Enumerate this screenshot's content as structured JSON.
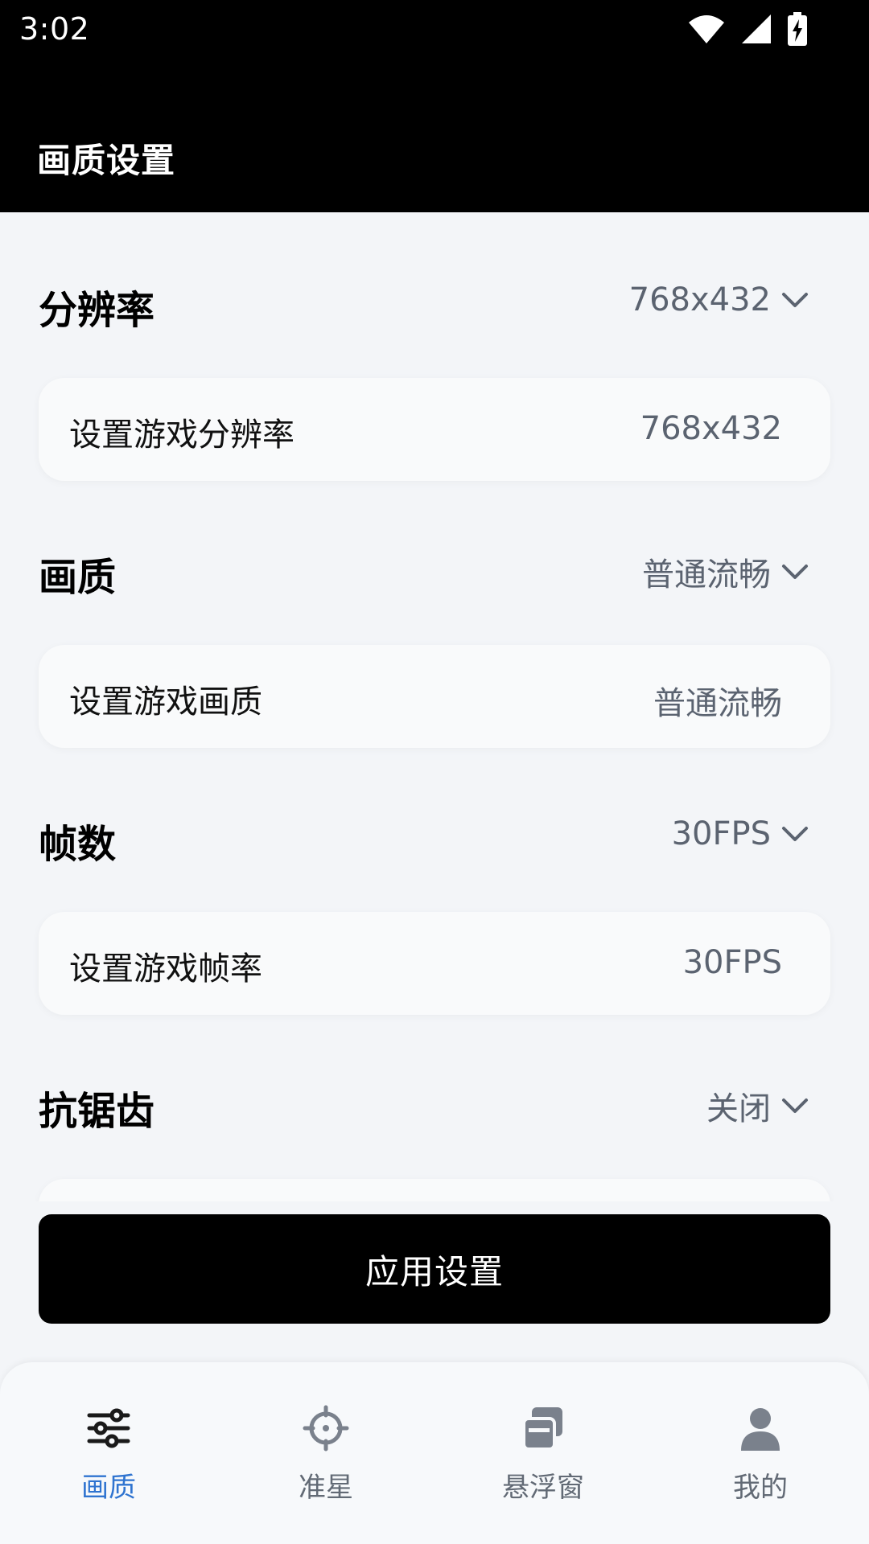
{
  "status_bar": {
    "time": "3:02",
    "icons": [
      "wifi-icon",
      "signal-icon",
      "battery-charging-icon"
    ]
  },
  "header": {
    "title": "画质设置"
  },
  "sections": [
    {
      "title": "分辨率",
      "dropdown_value": "768x432",
      "card_label": "设置游戏分辨率",
      "card_value": "768x432"
    },
    {
      "title": "画质",
      "dropdown_value": "普通流畅",
      "card_label": "设置游戏画质",
      "card_value": "普通流畅"
    },
    {
      "title": "帧数",
      "dropdown_value": "30FPS",
      "card_label": "设置游戏帧率",
      "card_value": "30FPS"
    },
    {
      "title": "抗锯齿",
      "dropdown_value": "关闭"
    }
  ],
  "apply_button": {
    "label": "应用设置"
  },
  "bottom_nav": {
    "items": [
      {
        "label": "画质",
        "icon": "sliders-icon",
        "active": true
      },
      {
        "label": "准星",
        "icon": "crosshair-icon",
        "active": false
      },
      {
        "label": "悬浮窗",
        "icon": "windows-icon",
        "active": false
      },
      {
        "label": "我的",
        "icon": "user-icon",
        "active": false
      }
    ]
  },
  "colors": {
    "active": "#2f74d0",
    "inactive": "#626a75",
    "background": "#f3f5f8"
  }
}
